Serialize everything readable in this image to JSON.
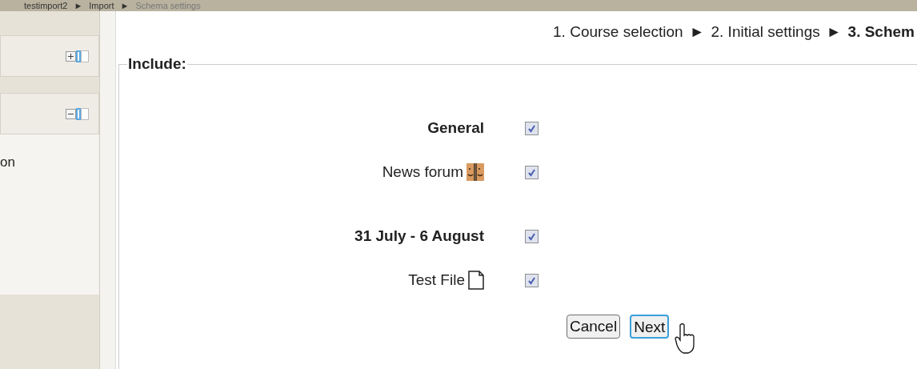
{
  "breadcrumb": [
    "testimport2",
    "Import",
    "Schema settings"
  ],
  "sidebar": {
    "blocks": [
      {
        "expanded": false
      },
      {
        "expanded": true,
        "content": "on"
      }
    ]
  },
  "steps": [
    {
      "label": "1. Course selection",
      "selected": false
    },
    {
      "label": "2. Initial settings",
      "selected": false
    },
    {
      "label": "3. Schem",
      "selected": true
    }
  ],
  "step_separator": "►",
  "include": {
    "legend": "Include:",
    "items": [
      {
        "kind": "section",
        "label": "General",
        "checked": true
      },
      {
        "kind": "forum",
        "label": "News forum",
        "checked": true
      },
      {
        "kind": "section",
        "label": "31 July - 6 August",
        "checked": true
      },
      {
        "kind": "file",
        "label": "Test File",
        "checked": true
      }
    ]
  },
  "buttons": [
    {
      "label": "Cancel",
      "focused": false
    },
    {
      "label": "Next",
      "focused": true
    }
  ]
}
